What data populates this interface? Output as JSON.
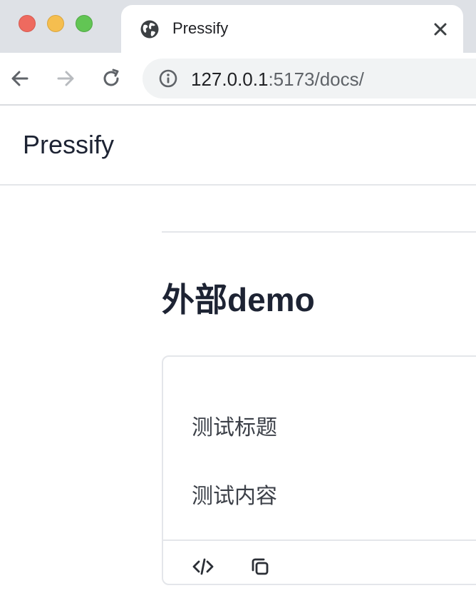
{
  "browser": {
    "tab": {
      "title": "Pressify",
      "favicon": "globe-icon"
    },
    "address": {
      "host": "127.0.0.1",
      "rest": ":5173/docs/"
    },
    "nav_icons": [
      "back-arrow-icon",
      "forward-arrow-icon",
      "reload-icon",
      "info-icon"
    ],
    "window_controls": {
      "close": "#ee6a5f",
      "minimize": "#f5be4f",
      "maximize": "#62c554"
    }
  },
  "site": {
    "logo": "Pressify"
  },
  "page": {
    "title": "外部demo",
    "demo": {
      "heading": "测试标题",
      "body": "测试内容",
      "actions": [
        "code-icon",
        "copy-icon"
      ]
    }
  },
  "colors": {
    "text_primary": "#1d2333",
    "border": "#e4e6ea",
    "tab_strip": "#dee1e6"
  }
}
